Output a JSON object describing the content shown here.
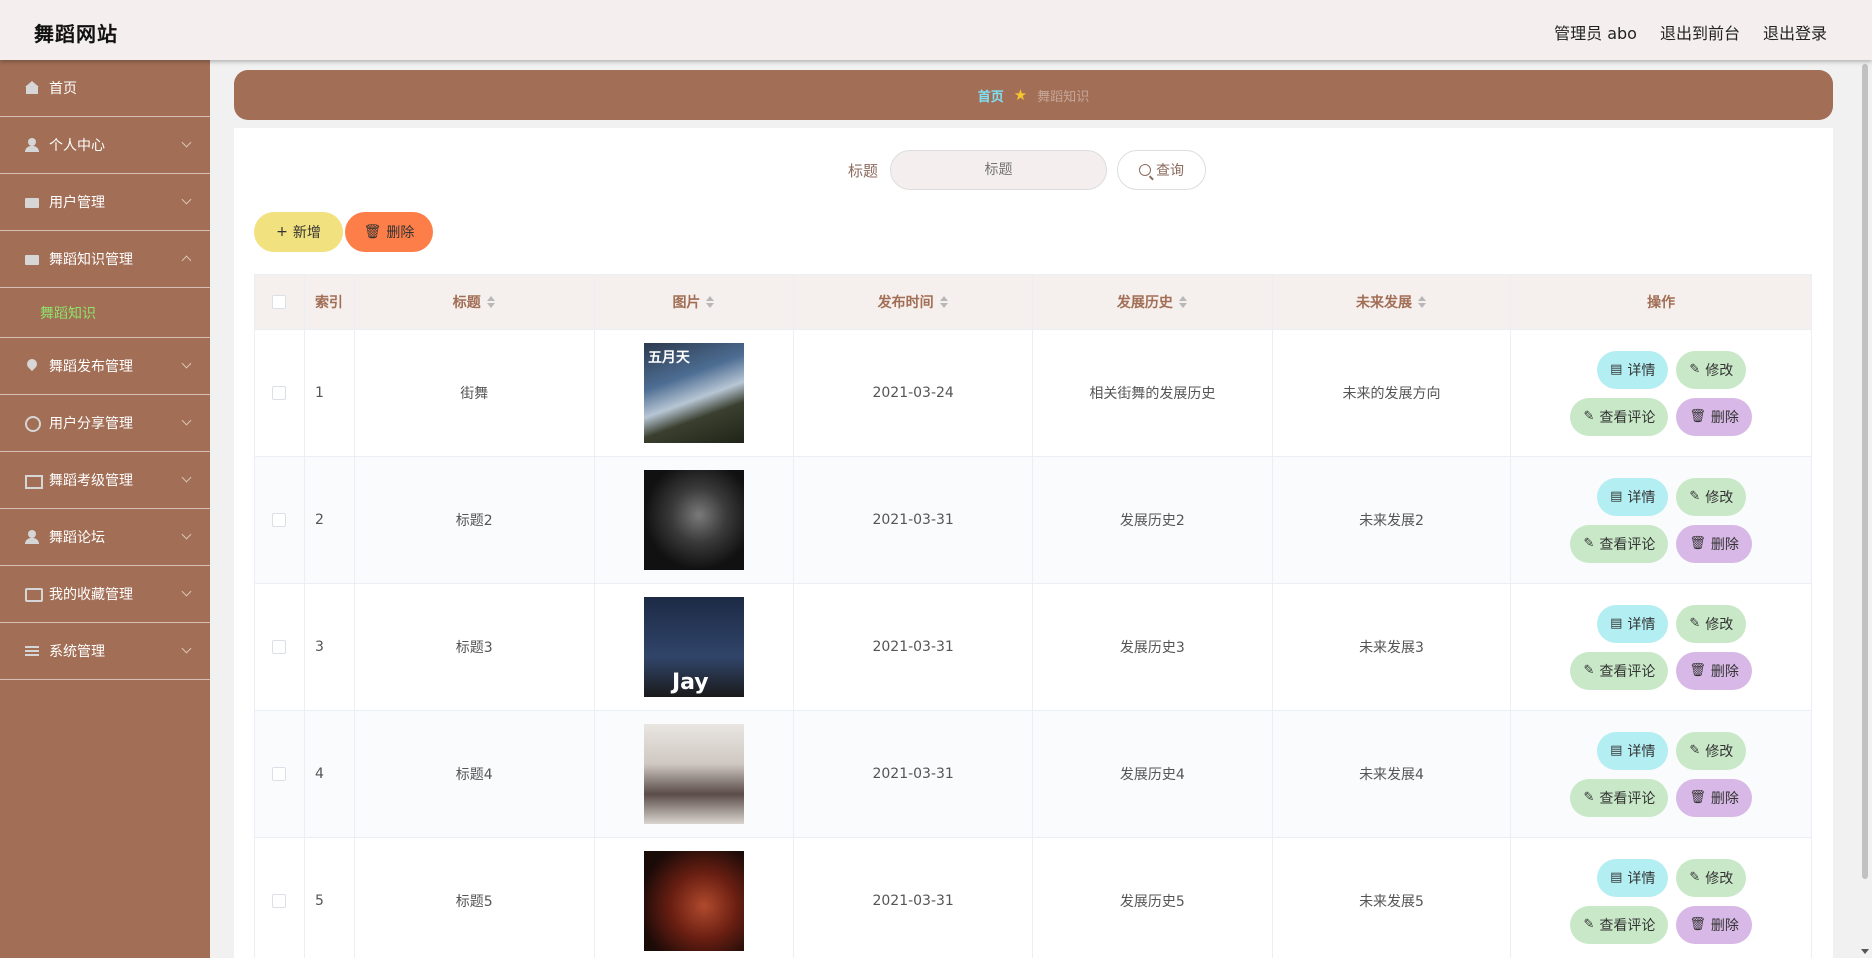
{
  "header": {
    "brand": "舞蹈网站",
    "nav": [
      "管理员 abo",
      "退出到前台",
      "退出登录"
    ]
  },
  "sidebar": {
    "items": [
      {
        "label": "首页",
        "icon": "home-icon",
        "chevron": "none"
      },
      {
        "label": "个人中心",
        "icon": "user-icon",
        "chevron": "down"
      },
      {
        "label": "用户管理",
        "icon": "box-icon",
        "chevron": "down"
      },
      {
        "label": "舞蹈知识管理",
        "icon": "briefcase-icon",
        "chevron": "up",
        "submenu": [
          "舞蹈知识"
        ]
      },
      {
        "label": "舞蹈发布管理",
        "icon": "location-icon",
        "chevron": "down"
      },
      {
        "label": "用户分享管理",
        "icon": "basketball-icon",
        "chevron": "down"
      },
      {
        "label": "舞蹈考级管理",
        "icon": "mail-icon",
        "chevron": "down"
      },
      {
        "label": "舞蹈论坛",
        "icon": "user-icon",
        "chevron": "down"
      },
      {
        "label": "我的收藏管理",
        "icon": "chat-icon",
        "chevron": "down"
      },
      {
        "label": "系统管理",
        "icon": "list-icon",
        "chevron": "down"
      }
    ]
  },
  "breadcrumb": {
    "home": "首页",
    "current": "舞蹈知识"
  },
  "search": {
    "label": "标题",
    "placeholder": "标题",
    "button": "查询"
  },
  "actions": {
    "add": "新增",
    "delete": "删除"
  },
  "table": {
    "columns": [
      "索引",
      "标题",
      "图片",
      "发布时间",
      "发展历史",
      "未来发展",
      "操作"
    ],
    "rows": [
      {
        "index": "1",
        "title": "街舞",
        "date": "2021-03-24",
        "history": "相关街舞的发展历史",
        "future": "未来的发展方向",
        "image_caption": "五月天"
      },
      {
        "index": "2",
        "title": "标题2",
        "date": "2021-03-31",
        "history": "发展历史2",
        "future": "未来发展2",
        "image_caption": ""
      },
      {
        "index": "3",
        "title": "标题3",
        "date": "2021-03-31",
        "history": "发展历史3",
        "future": "未来发展3",
        "image_caption": "Jay"
      },
      {
        "index": "4",
        "title": "标题4",
        "date": "2021-03-31",
        "history": "发展历史4",
        "future": "未来发展4",
        "image_caption": ""
      },
      {
        "index": "5",
        "title": "标题5",
        "date": "2021-03-31",
        "history": "发展历史5",
        "future": "未来发展5",
        "image_caption": ""
      }
    ],
    "row_ops": {
      "detail": "详情",
      "edit": "修改",
      "comment": "查看评论",
      "remove": "删除"
    }
  },
  "colors": {
    "primary": "#a26e55",
    "header_bg": "#f4eeee",
    "submenu_active": "#8ee36b",
    "crumb_home": "#7fe1f7"
  }
}
